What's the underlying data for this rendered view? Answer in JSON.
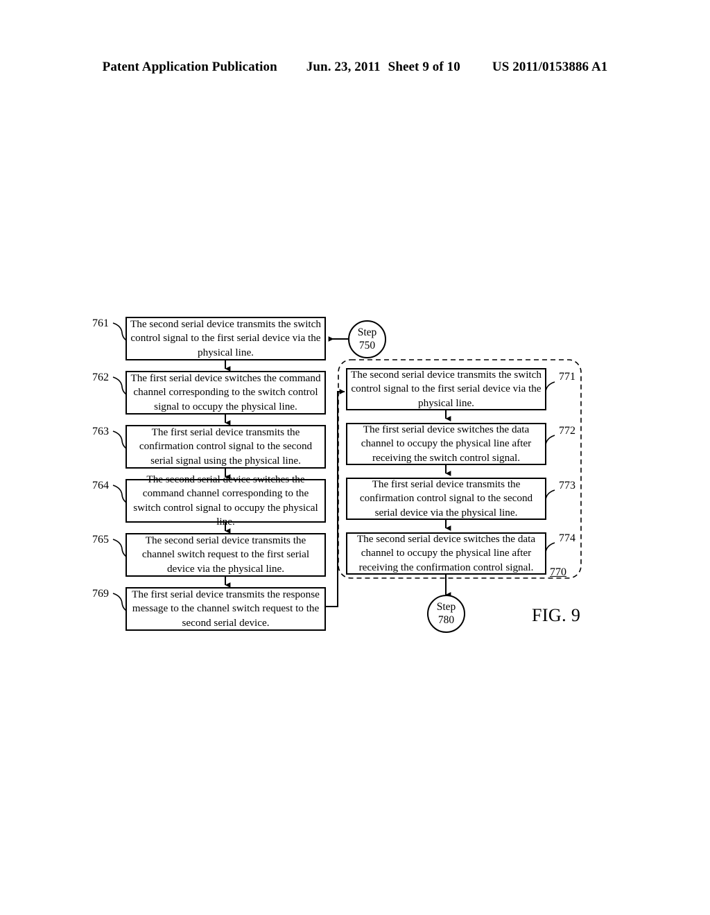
{
  "header": {
    "title": "Patent Application Publication",
    "date": "Jun. 23, 2011",
    "sheet": "Sheet 9 of 10",
    "publication_number": "US 2011/0153886 A1"
  },
  "figure": {
    "caption": "FIG. 9",
    "group_label": "770"
  },
  "left_flow": {
    "boxes": [
      {
        "ref": "761",
        "text": "The second serial device transmits the switch control signal to the first serial device via the physical line."
      },
      {
        "ref": "762",
        "text": "The first serial device switches the command channel corresponding to the switch control signal to occupy the physical line."
      },
      {
        "ref": "763",
        "text": "The first serial device transmits the confirmation control signal to the second serial signal using the physical line."
      },
      {
        "ref": "764",
        "text": "The second serial device switches the command channel corresponding to the switch control signal to occupy the physical line."
      },
      {
        "ref": "765",
        "text": "The second serial device transmits the channel switch request to the first serial device via the physical line."
      },
      {
        "ref": "769",
        "text": "The first serial device transmits the response message to the channel switch request to the second serial device."
      }
    ]
  },
  "right_flow": {
    "boxes": [
      {
        "ref": "771",
        "text": "The second serial device transmits the switch control signal to the first serial device via the physical line."
      },
      {
        "ref": "772",
        "text": "The first serial device switches the data channel to occupy the physical line after receiving the switch control signal."
      },
      {
        "ref": "773",
        "text": "The first serial device transmits the confirmation control signal to the second serial device via the physical line."
      },
      {
        "ref": "774",
        "text": "The second serial device switches the data channel to occupy the physical line after receiving the confirmation control signal."
      }
    ]
  },
  "steps": [
    {
      "label": "Step",
      "number": "750"
    },
    {
      "label": "Step",
      "number": "780"
    }
  ]
}
